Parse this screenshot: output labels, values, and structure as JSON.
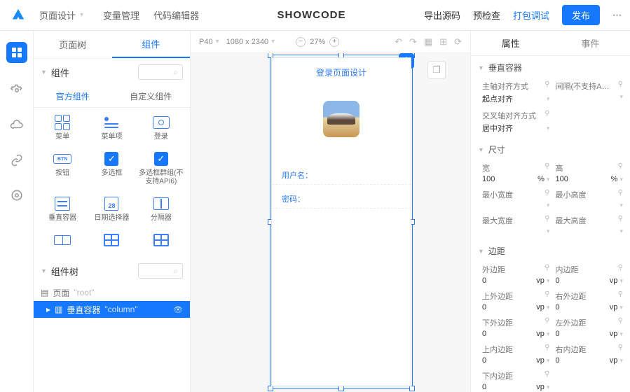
{
  "topbar": {
    "page_dd": "页面设计",
    "tabs": [
      "变量管理",
      "代码编辑器"
    ],
    "brand": "SHOWCODE",
    "right": {
      "export": "导出源码",
      "precheck": "预检查",
      "pack": "打包调试",
      "publish": "发布"
    }
  },
  "left": {
    "panel_tabs": {
      "tree": "页面树",
      "comp": "组件"
    },
    "section_comp": "组件",
    "comp_subtabs": {
      "official": "官方组件",
      "custom": "自定义组件"
    },
    "components": {
      "menu": "菜单",
      "menuitem": "菜单项",
      "record": "登录",
      "button": "按钮",
      "checkbox": "多选框",
      "checkboxgroup": "多选框群组(不支持API6)",
      "vbox": "垂直容器",
      "datepicker": "日期选择器",
      "divider": "分隔器"
    },
    "section_tree": "组件树",
    "tree": {
      "root": "页面",
      "root_meta": "\"root\"",
      "child": "垂直容器",
      "child_meta": "\"column\""
    }
  },
  "canvas": {
    "device": "P40",
    "size": "1080 x 2340",
    "zoom": "27%",
    "title": "登录页面设计",
    "field_user": "用户名：",
    "field_pass": "密码："
  },
  "right": {
    "tab_attr": "属性",
    "tab_event": "事件",
    "g_vbox": "垂直容器",
    "main_axis": "主轴对齐方式",
    "main_axis_val": "起点对齐",
    "gap_lbl": "间隔(不支持A…",
    "cross_axis": "交叉轴对齐方式",
    "cross_axis_val": "居中对齐",
    "g_size": "尺寸",
    "w_lbl": "宽",
    "w_val": "100",
    "w_unit": "%",
    "h_lbl": "高",
    "h_val": "100",
    "h_unit": "%",
    "minw_lbl": "最小宽度",
    "minh_lbl": "最小高度",
    "maxw_lbl": "最大宽度",
    "maxh_lbl": "最大高度",
    "g_margin": "边距",
    "m_out": "外边距",
    "m_in": "内边距",
    "m_t": "上外边距",
    "m_r": "右外边距",
    "m_b": "下外边距",
    "m_l": "左外边距",
    "p_t": "上内边距",
    "p_r": "右内边距",
    "p_b_label": "下内边距",
    "zero": "0",
    "vp": "vp"
  }
}
